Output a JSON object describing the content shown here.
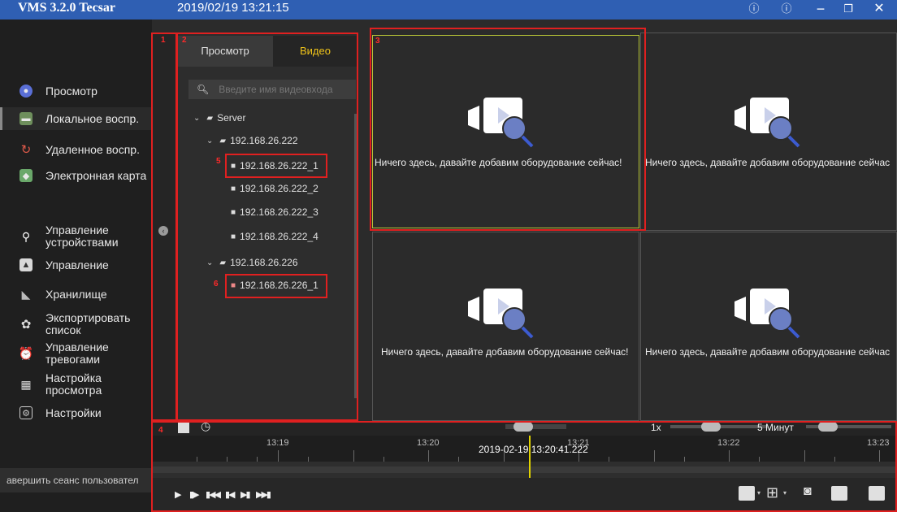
{
  "app": {
    "title": "VMS 3.2.0 Tecsar",
    "datetime": "2019/02/19 13:21:15"
  },
  "nav": {
    "items": [
      {
        "label": "Просмотр",
        "icon": "camera-lens-icon"
      },
      {
        "label": "Локальное воспр.",
        "icon": "local-playback-icon",
        "active": true
      },
      {
        "label": "Удаленное воспр.",
        "icon": "remote-playback-icon"
      },
      {
        "label": "Электронная карта",
        "icon": "map-icon"
      },
      {
        "label": "Управление устройствами",
        "icon": "device-management-icon"
      },
      {
        "label": "Управление",
        "icon": "user-management-icon"
      },
      {
        "label": "Хранилище",
        "icon": "storage-icon"
      },
      {
        "label": "Экспортировать список",
        "icon": "export-list-icon"
      },
      {
        "label": "Управление тревогами",
        "icon": "alarm-clock-icon"
      },
      {
        "label": "Настройка просмотра",
        "icon": "view-settings-grid-icon"
      },
      {
        "label": "Настройки",
        "icon": "settings-icon"
      }
    ],
    "logout": "авершить сеанс пользовател"
  },
  "panel": {
    "tabs": [
      "Просмотр",
      "Видео"
    ],
    "search_placeholder": "Введите имя видеовхода",
    "tree": {
      "root": "Server",
      "group1": "192.168.26.222",
      "group1_channels": [
        "192.168.26.222_1",
        "192.168.26.222_2",
        "192.168.26.222_3",
        "192.168.26.222_4"
      ],
      "group2": "192.168.26.226",
      "group2_channels": [
        "192.168.26.226_1"
      ]
    }
  },
  "video": {
    "empty_message": "Ничего здесь, давайте добавим оборудование сейчас!",
    "empty_message_cut": "Ничего здесь, давайте добавим оборудование сейчас"
  },
  "timeline": {
    "speed": "1x",
    "range": "5 Минут",
    "ticks": [
      "13:19",
      "13:20",
      "13:21",
      "13:22",
      "13:23"
    ],
    "cursor_datetime": "2019-02-19 13:20:41.222"
  },
  "annotations": [
    "1",
    "2",
    "3",
    "4",
    "5",
    "6"
  ],
  "colors": {
    "titlebar": "#2f5fb3",
    "tab_active_text": "#f0c419",
    "annotation": "#e02020",
    "cursor": "#e0d200",
    "selected_cell": "#b7c436"
  }
}
